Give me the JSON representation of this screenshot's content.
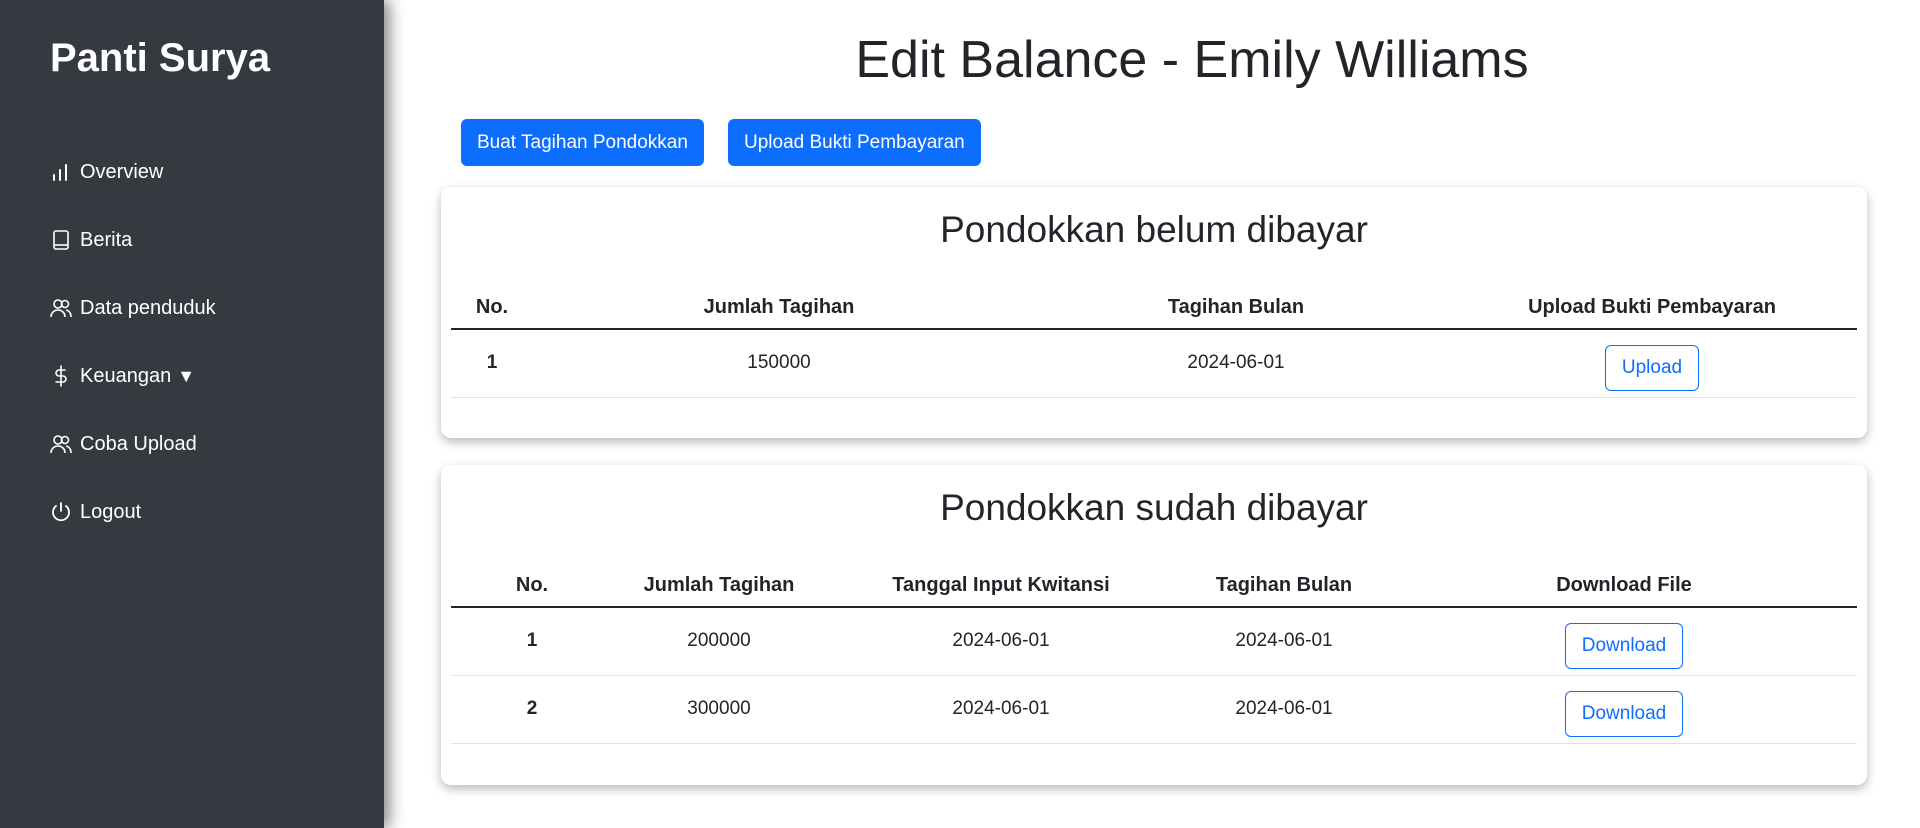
{
  "sidebar": {
    "brand": "Panti Surya",
    "items": [
      {
        "label": "Overview",
        "icon": "bar-chart-icon"
      },
      {
        "label": "Berita",
        "icon": "book-icon"
      },
      {
        "label": "Data penduduk",
        "icon": "people-icon"
      },
      {
        "label": "Keuangan",
        "icon": "dollar-icon",
        "caret": "▼"
      },
      {
        "label": "Coba Upload",
        "icon": "people-icon"
      },
      {
        "label": "Logout",
        "icon": "power-icon"
      }
    ]
  },
  "main": {
    "title": "Edit Balance - Emily Williams",
    "buttons": {
      "create": "Buat Tagihan Pondokkan",
      "upload": "Upload Bukti Pembayaran"
    },
    "unpaid": {
      "title": "Pondokkan belum dibayar",
      "headers": [
        "No.",
        "Jumlah Tagihan",
        "Tagihan Bulan",
        "Upload Bukti Pembayaran"
      ],
      "rows": [
        {
          "no": "1",
          "amount": "150000",
          "month": "2024-06-01",
          "action": "Upload"
        }
      ]
    },
    "paid": {
      "title": "Pondokkan sudah dibayar",
      "headers": [
        "No.",
        "Jumlah Tagihan",
        "Tanggal Input Kwitansi",
        "Tagihan Bulan",
        "Download File"
      ],
      "rows": [
        {
          "no": "1",
          "amount": "200000",
          "input_date": "2024-06-01",
          "month": "2024-06-01",
          "action": "Download"
        },
        {
          "no": "2",
          "amount": "300000",
          "input_date": "2024-06-01",
          "month": "2024-06-01",
          "action": "Download"
        }
      ]
    }
  },
  "colors": {
    "sidebar_bg": "#343a40",
    "primary": "#0d6efd"
  }
}
